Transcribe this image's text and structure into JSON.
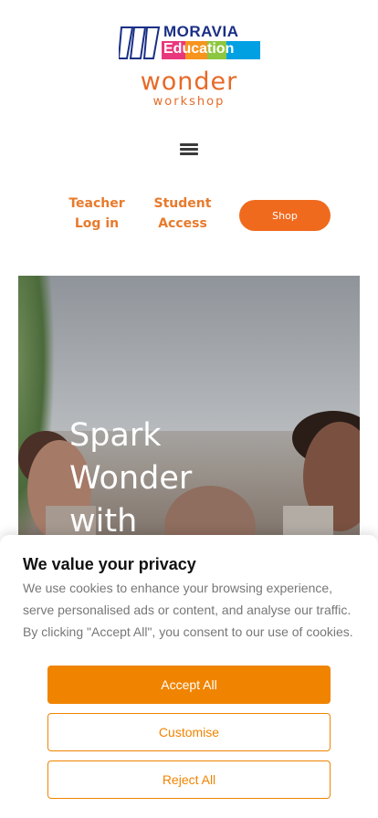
{
  "header": {
    "brand_top": "MORAVIA",
    "brand_bottom": "Education",
    "partner_name": "wonder",
    "partner_sub": "workshop",
    "brand_colors": [
      "#1a2f86",
      "#e9377d",
      "#f7941d",
      "#8dc63f",
      "#00a0e3",
      "#e76a28"
    ]
  },
  "nav": {
    "teacher_line1": "Teacher",
    "teacher_line2": "Log in",
    "student_line1": "Student",
    "student_line2": "Access",
    "shop_label": "Shop"
  },
  "hero": {
    "title_line1": "Spark",
    "title_line2": "Wonder",
    "title_line3": "with"
  },
  "cookie": {
    "title": "We value your privacy",
    "body": "We use cookies to enhance your browsing experience, serve personalised ads or content, and analyse our traffic. By clicking \"Accept All\", you consent to our use of cookies.",
    "accept_label": "Accept All",
    "customise_label": "Customise",
    "reject_label": "Reject All",
    "accent": "#f08400"
  }
}
